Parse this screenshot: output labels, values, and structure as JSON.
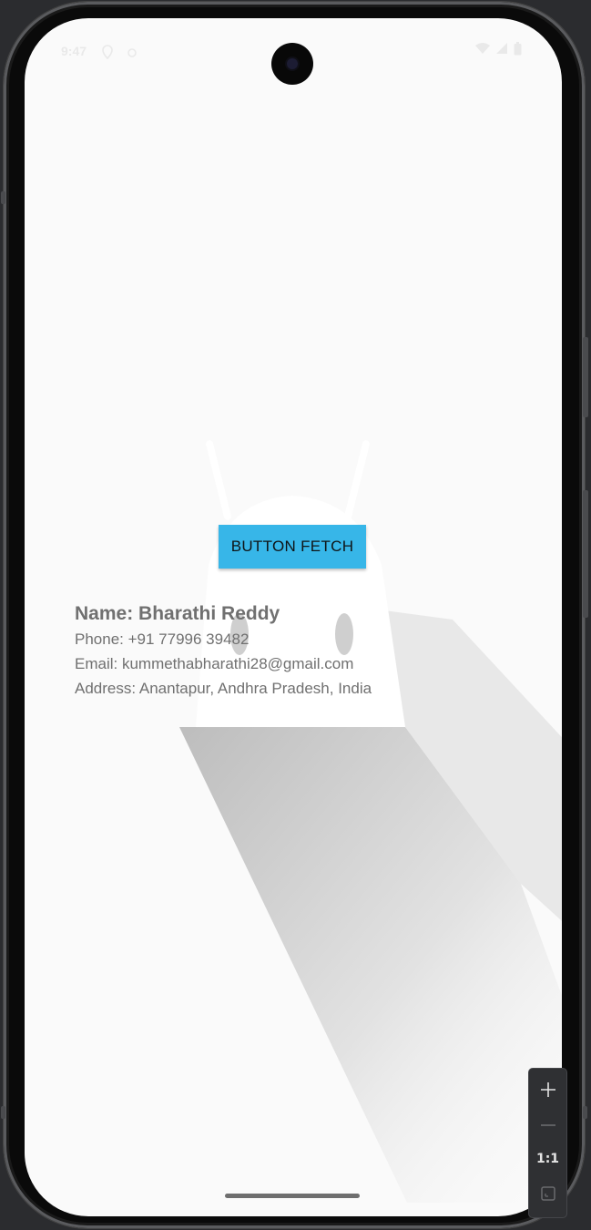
{
  "status_bar": {
    "time": "9:47"
  },
  "main": {
    "button_label": "BUTTON FETCH",
    "contact": {
      "name": "Name: Bharathi Reddy",
      "phone": "Phone: +91 77996 39482",
      "email": "Email: kummethabharathi28@gmail.com",
      "address": "Address: Anantapur, Andhra Pradesh, India"
    }
  },
  "zoom_controls": {
    "zoom_in_icon": "plus-icon",
    "zoom_out_icon": "minus-icon",
    "actual_size_label": "1:1",
    "fit_icon": "fit-screen-icon"
  },
  "colors": {
    "button": "#37b6e8",
    "screen_background": "#fafafa",
    "text": "#707070"
  }
}
